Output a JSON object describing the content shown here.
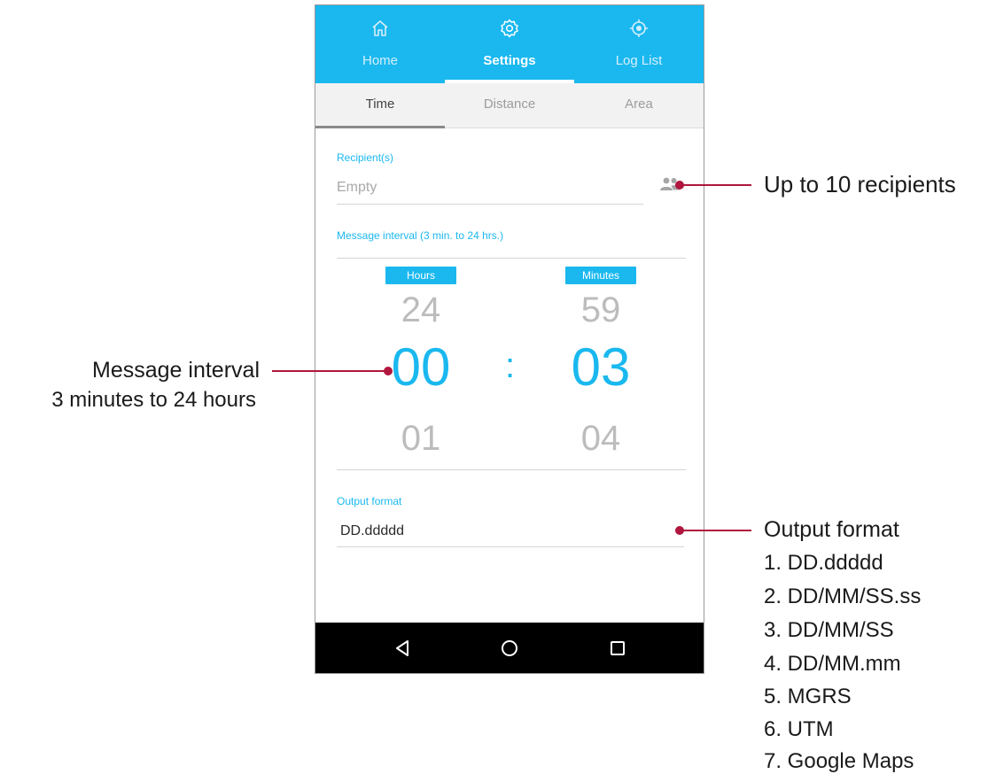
{
  "nav": {
    "tabs": [
      {
        "label": "Home",
        "icon": "home-icon"
      },
      {
        "label": "Settings",
        "icon": "gear-icon"
      },
      {
        "label": "Log List",
        "icon": "crosshair-icon"
      }
    ],
    "active": "Settings"
  },
  "subtabs": {
    "tabs": [
      {
        "label": "Time"
      },
      {
        "label": "Distance"
      },
      {
        "label": "Area"
      }
    ],
    "active": "Time"
  },
  "recipients": {
    "label": "Recipient(s)",
    "placeholder": "Empty",
    "icon": "contacts-icon"
  },
  "interval": {
    "label": "Message interval (3 min. to 24 hrs.)",
    "hours": {
      "badge": "Hours",
      "prev": "24",
      "current": "00",
      "next": "01"
    },
    "minutes": {
      "badge": "Minutes",
      "prev": "59",
      "current": "03",
      "next": "04"
    },
    "separator": ":"
  },
  "output": {
    "label": "Output format",
    "value": "DD.ddddd"
  },
  "system_nav": {
    "icons": [
      "back-icon",
      "home-circle-icon",
      "recents-icon"
    ]
  },
  "annotations": {
    "recipients": "Up to 10 recipients",
    "interval": {
      "title": "Message interval",
      "subtitle": "3 minutes to 24 hours"
    },
    "output": {
      "title": "Output format",
      "items": [
        "1. DD.ddddd",
        "2. DD/MM/SS.ss",
        "3. DD/MM/SS",
        "4. DD/MM.mm",
        "5. MGRS",
        "6. UTM",
        "7. Google Maps"
      ]
    }
  },
  "colors": {
    "accent": "#1ab8ef",
    "annotation": "#b0163e",
    "system_bar": "#000000"
  }
}
